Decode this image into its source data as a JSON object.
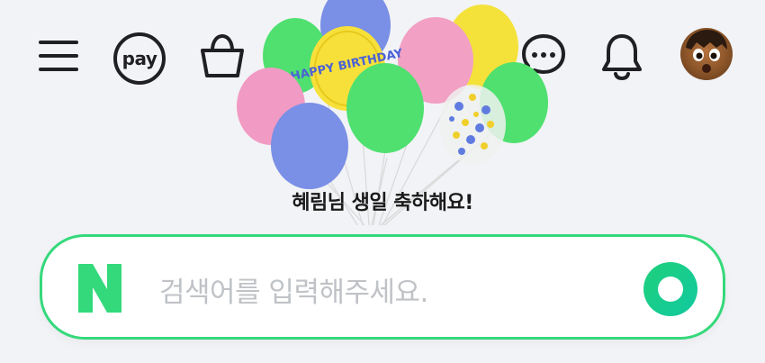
{
  "header": {
    "menu_icon": "hamburger-menu-icon",
    "pay_label": "pay",
    "cart_icon": "shopping-bag-icon",
    "chat_icon": "chat-bubble-icon",
    "bell_icon": "bell-icon",
    "avatar_icon": "user-avatar"
  },
  "banner": {
    "birthday_message": "혜림님 생일 축하해요!",
    "balloon_text": "HAPPY BIRTHDAY"
  },
  "search": {
    "logo_letter": "N",
    "placeholder": "검색어를 입력해주세요.",
    "submit_icon": "search-submit-icon"
  },
  "colors": {
    "accent": "#34d97b",
    "background": "#f2f3f6",
    "icon": "#1f1f24",
    "placeholder": "#bfc2c6"
  }
}
